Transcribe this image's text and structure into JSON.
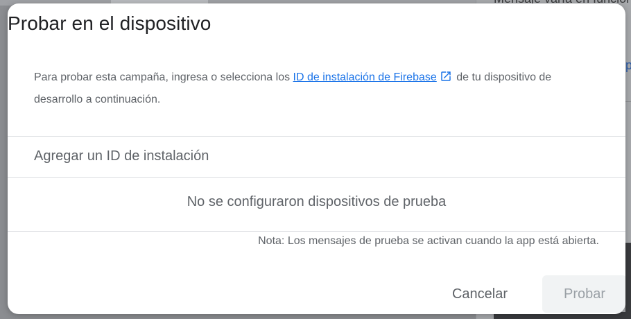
{
  "background": {
    "right_panel_text": "Mensaje varía en función",
    "right_link_fragment": "p"
  },
  "dialog": {
    "title": "Probar en el dispositivo",
    "intro_before_link": "Para probar esta campaña, ingresa o selecciona los ",
    "intro_link": "ID de instalación de Firebase",
    "intro_after_link": " de tu dispositivo de desarrollo a continuación.",
    "add_id_placeholder": "Agregar un ID de instalación",
    "empty_state": "No se configuraron dispositivos de prueba",
    "note": "Nota: Los mensajes de prueba se activan cuando la app está abierta.",
    "cancel_label": "Cancelar",
    "test_label": "Probar"
  },
  "colors": {
    "link": "#1a73e8",
    "text_primary": "#202124",
    "text_secondary": "#5f6368",
    "disabled_button_bg": "#f1f3f4",
    "disabled_button_text": "#9aa0a6",
    "scrim": "#8b8d91"
  },
  "icons": {
    "external_link": "open-in-new-icon"
  }
}
